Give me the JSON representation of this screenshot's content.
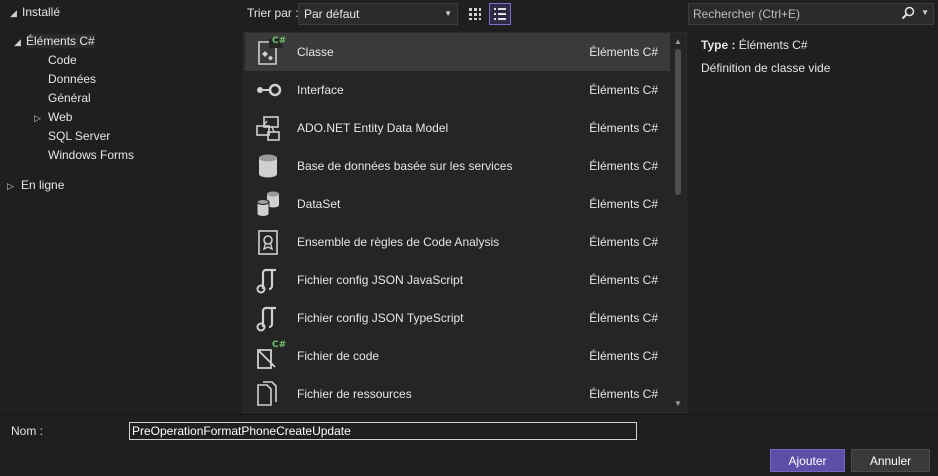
{
  "tree": {
    "installed": "Installé",
    "csharp_items": "Éléments C#",
    "code": "Code",
    "data": "Données",
    "general": "Général",
    "web": "Web",
    "sql_server": "SQL Server",
    "windows_forms": "Windows Forms",
    "online": "En ligne"
  },
  "sort": {
    "label": "Trier par :",
    "value": "Par défaut"
  },
  "search": {
    "placeholder": "Rechercher (Ctrl+E)"
  },
  "templates": [
    {
      "name": "Classe",
      "lang": "Éléments C#",
      "icon": "class-icon"
    },
    {
      "name": "Interface",
      "lang": "Éléments C#",
      "icon": "interface-icon"
    },
    {
      "name": "ADO.NET Entity Data Model",
      "lang": "Éléments C#",
      "icon": "entity-model-icon"
    },
    {
      "name": "Base de données basée sur les services",
      "lang": "Éléments C#",
      "icon": "database-icon"
    },
    {
      "name": "DataSet",
      "lang": "Éléments C#",
      "icon": "dataset-icon"
    },
    {
      "name": "Ensemble de règles de Code Analysis",
      "lang": "Éléments C#",
      "icon": "ruleset-icon"
    },
    {
      "name": "Fichier config JSON JavaScript",
      "lang": "Éléments C#",
      "icon": "json-config-icon"
    },
    {
      "name": "Fichier config JSON TypeScript",
      "lang": "Éléments C#",
      "icon": "json-config-icon"
    },
    {
      "name": "Fichier de code",
      "lang": "Éléments C#",
      "icon": "code-file-icon"
    },
    {
      "name": "Fichier de ressources",
      "lang": "Éléments C#",
      "icon": "resource-file-icon"
    }
  ],
  "details": {
    "type_label": "Type :",
    "type_value": "Éléments C#",
    "description": "Définition de classe vide"
  },
  "bottom": {
    "name_label": "Nom :",
    "name_value": "PreOperationFormatPhoneCreateUpdate",
    "add_label": "Ajouter",
    "cancel_label": "Annuler"
  },
  "colors": {
    "background": "#1f1f1f",
    "accent": "#5c4fa8",
    "csharp_badge": "#6fc26f"
  }
}
